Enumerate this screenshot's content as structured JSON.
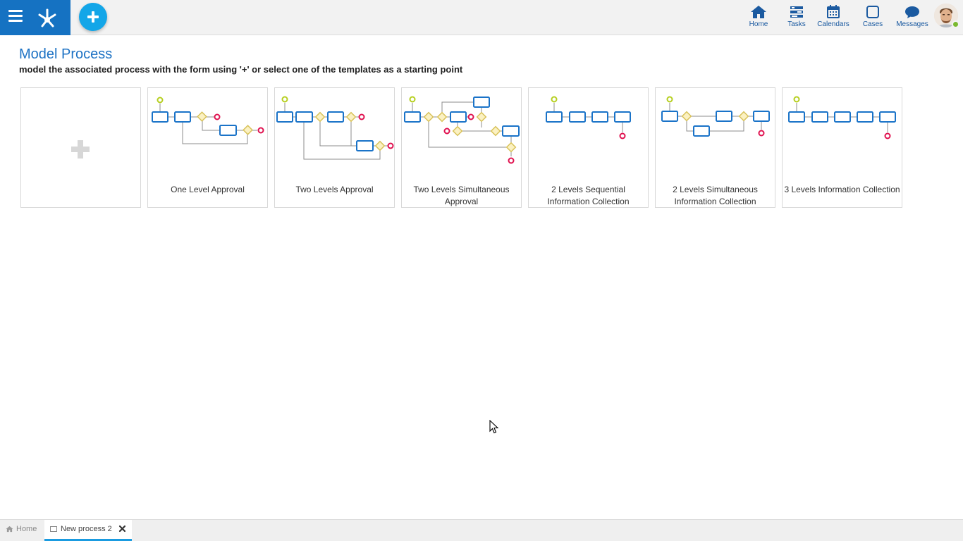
{
  "header": {
    "nav": [
      {
        "id": "home",
        "label": "Home",
        "icon": "home-icon"
      },
      {
        "id": "tasks",
        "label": "Tasks",
        "icon": "tasks-icon"
      },
      {
        "id": "calendars",
        "label": "Calendars",
        "icon": "calendar-icon"
      },
      {
        "id": "cases",
        "label": "Cases",
        "icon": "cases-icon"
      },
      {
        "id": "messages",
        "label": "Messages",
        "icon": "chat-bubble-icon"
      }
    ],
    "status_color": "#7ab92f",
    "brand_color": "#1572c2"
  },
  "page": {
    "title": "Model Process",
    "subtitle": "model the associated process with the form using '+' or select one of the templates as a starting point"
  },
  "templates": [
    {
      "label": "One Level Approval"
    },
    {
      "label": "Two Levels Approval"
    },
    {
      "label": "Two Levels Simultaneous Approval"
    },
    {
      "label": "2 Levels Sequential Information Collection"
    },
    {
      "label": "2 Levels Simultaneous Information Collection"
    },
    {
      "label": "3 Levels Information Collection"
    }
  ],
  "tabs": [
    {
      "label": "Home",
      "icon": "home-icon"
    },
    {
      "label": "New process 2",
      "icon": "document-icon"
    }
  ]
}
